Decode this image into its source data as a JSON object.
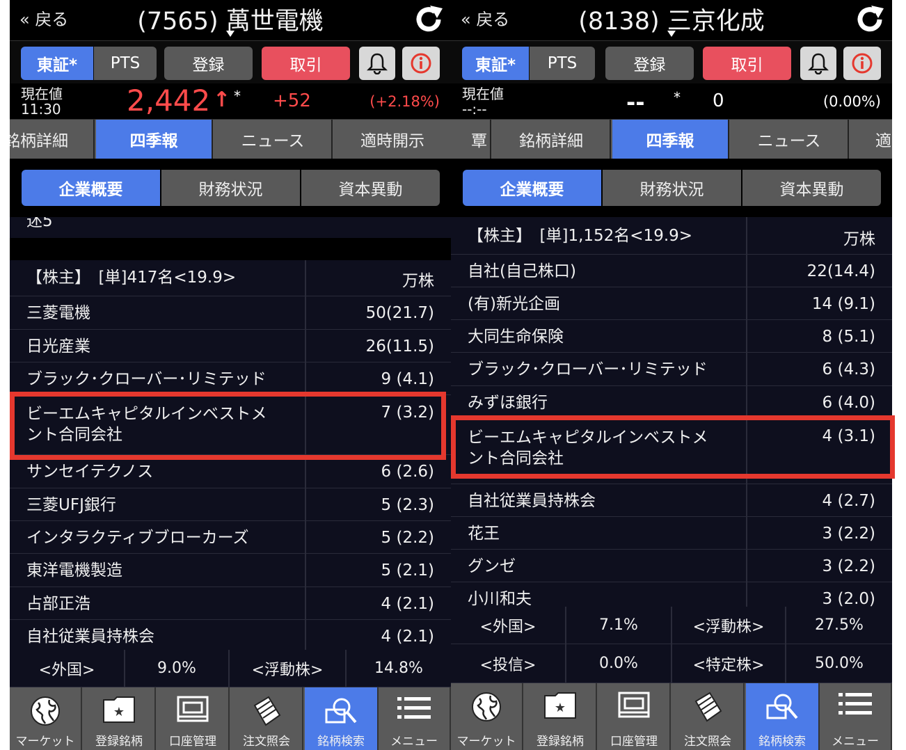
{
  "left": {
    "back_label": "« 戻る",
    "stock_title": "(7565) 萬世電機",
    "market_tab": "東証*",
    "pts_tab": "PTS",
    "register_button": "登録",
    "trade_button": "取引",
    "price_label_1": "現在値",
    "price_time": "11:30",
    "price_value": "2,442",
    "price_arrow": "↑",
    "price_mark": "*",
    "price_change": "+52",
    "price_change_pct": "(+2.18%)",
    "tabs": [
      "銘柄詳細",
      "四季報",
      "ニュース",
      "適時開示"
    ],
    "subtabs": [
      "企業概要",
      "財務状況",
      "資本異動"
    ],
    "partial_text": "述5",
    "shareholders_header": "【株主】　[単]417名<19.9>",
    "shares_unit": "万株",
    "shareholders": [
      {
        "name": "三菱電機",
        "value": "50(21.7)"
      },
      {
        "name": "日光産業",
        "value": "26(11.5)"
      },
      {
        "name": "ブラック･クローバー･リミテッド",
        "value": "9 (4.1)"
      },
      {
        "name": "ビーエムキャピタルインベストメ",
        "name2": "ント合同会社",
        "value": "7 (3.2)"
      },
      {
        "name": "サンセイテクノス",
        "value": "6 (2.6)"
      },
      {
        "name": "三菱UFJ銀行",
        "value": "5 (2.3)"
      },
      {
        "name": "インタラクティブブローカーズ",
        "value": "5 (2.2)"
      },
      {
        "name": "東洋電機製造",
        "value": "5 (2.1)"
      },
      {
        "name": "占部正浩",
        "value": "4 (2.1)"
      },
      {
        "name": "自社従業員持株会",
        "value": "4 (2.1)"
      }
    ],
    "summary": [
      [
        "<外国>",
        "9.0%",
        "<浮動株>",
        "14.8%"
      ]
    ],
    "nav": [
      "マーケット",
      "登録銘柄",
      "口座管理",
      "注文照会",
      "銘柄検索",
      "メニュー"
    ]
  },
  "right": {
    "back_label": "« 戻る",
    "stock_title": "(8138) 三京化成",
    "market_tab": "東証*",
    "pts_tab": "PTS",
    "register_button": "登録",
    "trade_button": "取引",
    "price_label_1": "現在値",
    "price_time": "--:--",
    "price_value": "--",
    "price_mark": "*",
    "price_change": "0",
    "price_change_pct": "(0.00%)",
    "tabs": [
      "銘柄詳細",
      "四季報",
      "ニュース",
      "適"
    ],
    "tab_edge_left": "覃",
    "subtabs": [
      "企業概要",
      "財務状況",
      "資本異動"
    ],
    "shareholders_header": "【株主】　[単]1,152名<19.9>",
    "shares_unit": "万株",
    "shareholders": [
      {
        "name": "自社(自己株口)",
        "value": "22(14.4)"
      },
      {
        "name": "(有)新光企画",
        "value": "14 (9.1)"
      },
      {
        "name": "大同生命保険",
        "value": "8 (5.1)"
      },
      {
        "name": "ブラック･クローバー･リミテッド",
        "value": "6 (4.3)"
      },
      {
        "name": "みずほ銀行",
        "value": "6 (4.0)"
      },
      {
        "name": "ビーエムキャピタルインベストメ",
        "name2": "ント合同会社",
        "value": "4 (3.1)"
      },
      {
        "name": "自社従業員持株会",
        "value": "4 (2.7)"
      },
      {
        "name": "花王",
        "value": "3 (2.2)"
      },
      {
        "name": "グンゼ",
        "value": "3 (2.2)"
      },
      {
        "name": "小川和夫",
        "value": "3 (2.0)"
      }
    ],
    "summary": [
      [
        "<外国>",
        "7.1%",
        "<浮動株>",
        "27.5%"
      ],
      [
        "<投信>",
        "0.0%",
        "<特定株>",
        "50.0%"
      ]
    ],
    "nav": [
      "マーケット",
      "登録銘柄",
      "口座管理",
      "注文照会",
      "銘柄検索",
      "メニュー"
    ]
  },
  "colors": {
    "accent_blue": "#4c7be8",
    "trade_red": "#e8505e",
    "price_up_red": "#ff4b4b",
    "highlight_red": "#e5382e",
    "table_bg": "#0e0f1e"
  }
}
